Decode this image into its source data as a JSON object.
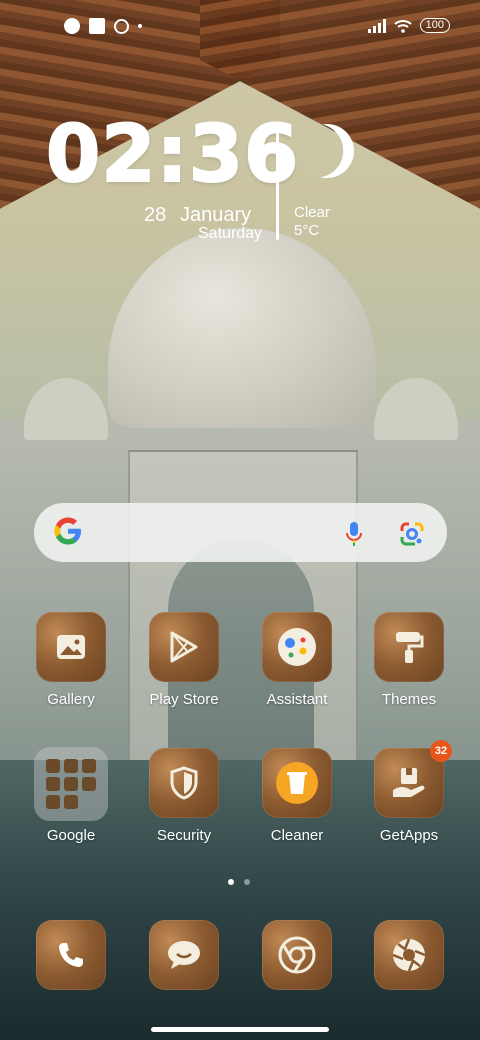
{
  "status_bar": {
    "battery": "100",
    "icons_left": [
      "app-notification-icon",
      "square-notification-icon",
      "location-pin-icon",
      "dot-icon"
    ],
    "icons_right": [
      "signal-icon",
      "wifi-icon",
      "battery-icon"
    ]
  },
  "clock_widget": {
    "time": "02:36",
    "day": "28",
    "month": "January",
    "weekday": "Saturday",
    "weather_condition": "Clear",
    "temperature": "5°C",
    "weather_icon": "moon-icon"
  },
  "search": {
    "logo": "google-g-icon",
    "mic_icon": "mic-icon",
    "lens_icon": "google-lens-icon"
  },
  "apps_row1": [
    {
      "label": "Gallery",
      "icon": "gallery-icon"
    },
    {
      "label": "Play Store",
      "icon": "play-store-icon"
    },
    {
      "label": "Assistant",
      "icon": "assistant-icon"
    },
    {
      "label": "Themes",
      "icon": "themes-icon"
    }
  ],
  "apps_row2": [
    {
      "label": "Google",
      "icon": "folder-icon"
    },
    {
      "label": "Security",
      "icon": "shield-icon"
    },
    {
      "label": "Cleaner",
      "icon": "cleaner-icon"
    },
    {
      "label": "GetApps",
      "icon": "getapps-icon",
      "badge": "32"
    }
  ],
  "dock": [
    {
      "icon": "phone-icon"
    },
    {
      "icon": "messages-icon"
    },
    {
      "icon": "chrome-icon"
    },
    {
      "icon": "camera-icon"
    }
  ],
  "pager": {
    "pages": 2,
    "current": 1
  },
  "colors": {
    "accent_badge": "#e8561c",
    "icon_bg": "#8b5a30",
    "search_bg": "#f0f2f0"
  }
}
